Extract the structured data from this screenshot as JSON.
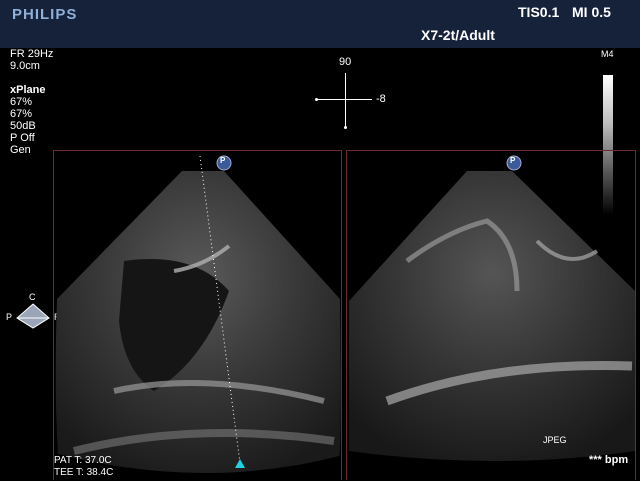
{
  "header": {
    "brand": "PHILIPS",
    "tis": "TIS0.1",
    "mi": "MI 0.5",
    "probe_preset": "X7-2t/Adult"
  },
  "params": {
    "frame_rate": "FR 29Hz",
    "depth": "9.0cm",
    "mode": "xPlane",
    "gain_1": "67%",
    "gain_2": "67%",
    "dynamic_range": "50dB",
    "persistence": "P Off",
    "preset": "Gen"
  },
  "plane_indicator": {
    "angle_primary": "90",
    "angle_secondary": "-8"
  },
  "grayscale_map": {
    "label": "M4"
  },
  "orientation": {
    "top": "C",
    "left": "P",
    "right": "R"
  },
  "panels": {
    "left_marker": "P",
    "right_marker": "P"
  },
  "footer": {
    "patient_temp": "PAT T: 37.0C",
    "tee_temp": "TEE T: 38.4C",
    "format": "JPEG",
    "heart_rate": "*** bpm"
  },
  "colors": {
    "header_bg": "#16213a",
    "brand": "#8fb0d8",
    "panel_border": "#6a2b2b",
    "scanline_marker": "#22d0e0"
  }
}
